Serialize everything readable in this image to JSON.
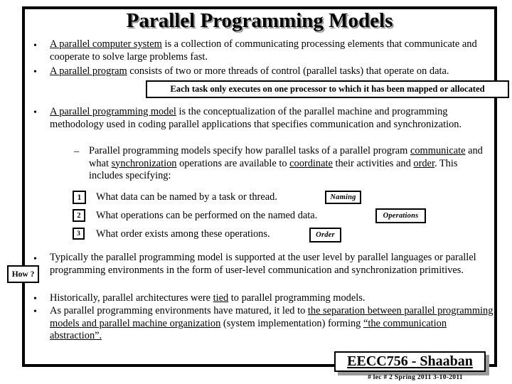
{
  "slide": {
    "title": "Parallel Programming Models",
    "bullets": [
      {
        "id": "b1",
        "marker": "•",
        "segments": [
          {
            "text": "A parallel computer system",
            "underline": true
          },
          {
            "text": " is a collection of communicating processing elements that communicate and cooperate to solve large problems fast.",
            "underline": false
          }
        ]
      },
      {
        "id": "b2",
        "marker": "•",
        "segments": [
          {
            "text": "A parallel program",
            "underline": true
          },
          {
            "text": " consists of two or more threads of control (parallel tasks) that operate on data.",
            "underline": false
          }
        ]
      },
      {
        "id": "b3",
        "marker": "•",
        "segments": [
          {
            "text": "A parallel programming model",
            "underline": true
          },
          {
            "text": " is the conceptualization of the parallel machine and programming methodology used in coding parallel applications that specifies communication and synchronization.",
            "underline": false
          }
        ]
      },
      {
        "id": "b4",
        "marker": "–",
        "segments": [
          {
            "text": "Parallel programming models specify how parallel tasks of a parallel program ",
            "underline": false
          },
          {
            "text": "communicate",
            "underline": true
          },
          {
            "text": "  and what ",
            "underline": false
          },
          {
            "text": "synchronization",
            "underline": true
          },
          {
            "text": " operations are available to ",
            "underline": false
          },
          {
            "text": "coordinate",
            "underline": true
          },
          {
            "text": " their activities and ",
            "underline": false
          },
          {
            "text": "order",
            "underline": true
          },
          {
            "text": ".  This includes specifying:",
            "underline": false
          }
        ]
      },
      {
        "id": "b5",
        "marker": "•",
        "segments": [
          {
            "text": "Typically the parallel programming model is supported at the user level by parallel languages or parallel programming environments in the form of user-level communication and synchronization primitives.",
            "underline": false
          }
        ]
      },
      {
        "id": "b6",
        "marker": "•",
        "segments": [
          {
            "text": "Historically, parallel architectures were ",
            "underline": false
          },
          {
            "text": "tied",
            "underline": true
          },
          {
            "text": " to parallel programming models.",
            "underline": false
          }
        ]
      },
      {
        "id": "b7",
        "marker": "•",
        "segments": [
          {
            "text": "As parallel programming environments have matured, it led to ",
            "underline": false
          },
          {
            "text": "the separation between parallel programming models and parallel machine organization",
            "underline": true
          },
          {
            "text": " (system implementation) forming ",
            "underline": false
          },
          {
            "text": "“the communication abstraction”.",
            "underline": true
          }
        ]
      }
    ],
    "callout": "Each task only executes on one processor to which it has been mapped or allocated",
    "numbered_items": [
      {
        "number": "1",
        "text": "What data can be named by a task or thread.",
        "tag": "Naming"
      },
      {
        "number": "2",
        "text": "What operations can be performed on the named data.",
        "tag": "Operations"
      },
      {
        "number": "3",
        "text": "What order exists among these operations.",
        "tag": "Order"
      }
    ],
    "how_label": "How ?",
    "footer": {
      "course": "EECC756 - Shaaban",
      "meta": "#  lec # 2    Spring 2011   3-10-2011"
    },
    "colors": {
      "text": "#000000",
      "background": "#ffffff",
      "border": "#000000",
      "shadow": "#9a9a9a"
    }
  }
}
